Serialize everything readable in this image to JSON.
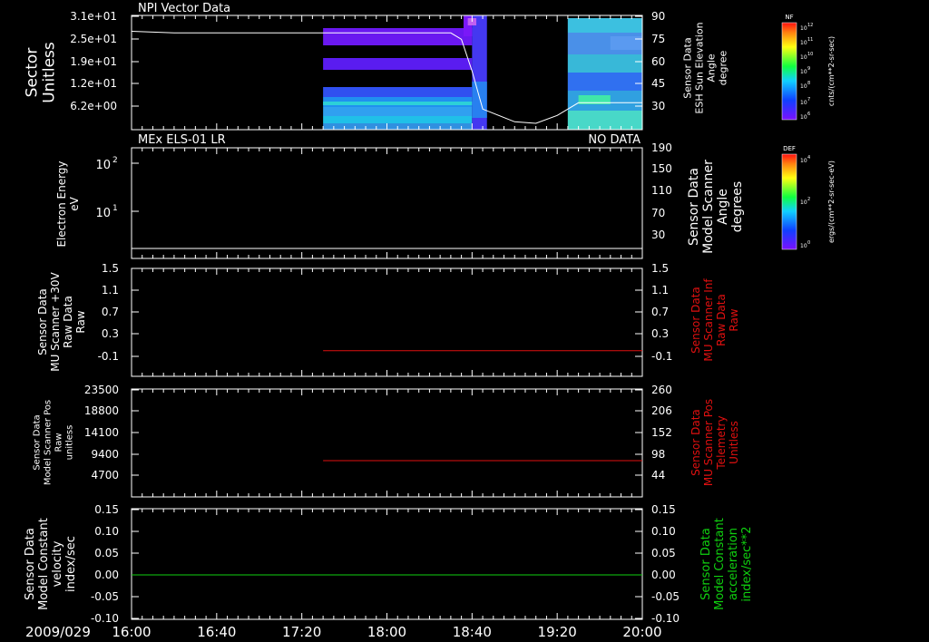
{
  "date_label": "2009/029",
  "x_ticks": [
    "16:00",
    "16:40",
    "17:20",
    "18:00",
    "18:40",
    "19:20",
    "20:00"
  ],
  "colors": {
    "axis": "#ffffff",
    "red": "#e01010",
    "green": "#10d010",
    "bg": "#000000"
  },
  "panels": [
    {
      "title": "NPI Vector Data",
      "status": "",
      "left_label": [
        "Sector",
        "Unitless"
      ],
      "left_ticks": [
        "3.1e+01",
        "2.5e+01",
        "1.9e+01",
        "1.2e+01",
        "6.2e+00"
      ],
      "right_label": [
        "Sensor Data",
        "ESH Sun Elevation",
        "Angle",
        "degree"
      ],
      "right_ticks": [
        "90",
        "75",
        "60",
        "45",
        "30"
      ]
    },
    {
      "title": "MEx ELS-01 LR",
      "status": "NO DATA",
      "left_label": [
        "Electron Energy",
        "eV"
      ],
      "left_ticks": [
        "10",
        "10"
      ],
      "left_tick_exps": [
        "2",
        "1"
      ],
      "right_label": [
        "Sensor Data",
        "Model Scanner",
        "Angle",
        "degrees"
      ],
      "right_ticks": [
        "190",
        "150",
        "110",
        "70",
        "30"
      ]
    },
    {
      "title": "",
      "status": "",
      "left_label": [
        "Sensor Data",
        "MU Scanner +30V",
        "Raw Data",
        "Raw"
      ],
      "left_ticks": [
        "1.5",
        "1.1",
        "0.7",
        "0.3",
        "-0.1"
      ],
      "right_label": [
        "Sensor Data",
        "MU Scanner Inf",
        "Raw Data",
        "Raw"
      ],
      "right_ticks": [
        "1.5",
        "1.1",
        "0.7",
        "0.3",
        "-0.1"
      ]
    },
    {
      "title": "",
      "status": "",
      "left_label": [
        "Sensor Data",
        "Model Scanner Pos",
        "Raw",
        "unitless"
      ],
      "left_ticks": [
        "23500",
        "18800",
        "14100",
        "9400",
        "4700"
      ],
      "right_label": [
        "Sensor Data",
        "MU Scanner Pos",
        "Telemetry",
        "Unitless"
      ],
      "right_ticks": [
        "260",
        "206",
        "152",
        "98",
        "44"
      ]
    },
    {
      "title": "",
      "status": "",
      "left_label": [
        "Sensor Data",
        "Model Constant",
        "velocity",
        "index/sec"
      ],
      "left_ticks": [
        "0.15",
        "0.10",
        "0.05",
        "0.00",
        "-0.05",
        "-0.10"
      ],
      "right_label": [
        "Sensor Data",
        "Model Constant",
        "acceleration",
        "index/sec**2"
      ],
      "right_ticks": [
        "0.15",
        "0.10",
        "0.05",
        "0.00",
        "-0.05",
        "-0.10"
      ]
    }
  ],
  "colorbars": [
    {
      "title": "NF",
      "unit": "cnts/(cm**2-sr-sec)",
      "ticks": [
        "10",
        "10",
        "10",
        "10",
        "10",
        "10",
        "10"
      ],
      "tick_exps": [
        "12",
        "11",
        "10",
        "9",
        "8",
        "7",
        "6"
      ]
    },
    {
      "title": "DEF",
      "unit": "ergs/(cm**2-sr-sec-eV)",
      "ticks": [
        "10",
        "10",
        "10"
      ],
      "tick_exps": [
        "4",
        "2",
        "0"
      ]
    }
  ],
  "chart_data": [
    {
      "type": "heatmap",
      "title": "NPI Vector Data",
      "xlabel": "",
      "ylabel": "Sector Unitless",
      "x_range": [
        "16:00",
        "20:00"
      ],
      "y_ticks": [
        31,
        25,
        19,
        12,
        6.2
      ],
      "overlay_line": {
        "name": "Sensor Data ESH Sun Elevation Angle",
        "unit": "degree",
        "x": [
          "16:00",
          "16:20",
          "18:30",
          "18:35",
          "18:40",
          "18:45",
          "19:00",
          "19:10",
          "19:20",
          "19:30",
          "20:00"
        ],
        "y": [
          80,
          79,
          79,
          75,
          55,
          31,
          23,
          22,
          27,
          35,
          35
        ]
      },
      "y2_ticks": [
        90,
        75,
        60,
        45,
        30
      ]
    },
    {
      "type": "line",
      "title": "MEx ELS-01 LR",
      "status": "NO DATA",
      "ylabel": "Electron Energy eV",
      "y_scale": "log",
      "series": [
        {
          "name": "Sensor Data Model Scanner Angle",
          "x": [
            "16:00",
            "20:00"
          ],
          "y": [
            16,
            16
          ]
        }
      ],
      "y2_ticks": [
        190,
        150,
        110,
        70,
        30
      ]
    },
    {
      "type": "line",
      "ylabel": "Sensor Data MU Scanner +30V Raw Data Raw",
      "ylim": [
        -0.3,
        1.5
      ],
      "series": [
        {
          "name": "Sensor Data MU Scanner Inf Raw Data Raw",
          "color": "#e01010",
          "x": [
            "17:30",
            "20:00"
          ],
          "y": [
            0.0,
            0.0
          ]
        }
      ]
    },
    {
      "type": "line",
      "ylabel": "Sensor Data Model Scanner Pos Raw unitless",
      "ylim": [
        0,
        23500
      ],
      "series": [
        {
          "name": "Sensor Data MU Scanner Pos Telemetry Unitless",
          "color": "#e01010",
          "x": [
            "17:30",
            "20:00"
          ],
          "y": [
            98,
            98
          ]
        }
      ],
      "y2_ticks": [
        260,
        206,
        152,
        98,
        44
      ]
    },
    {
      "type": "line",
      "ylabel": "Sensor Data Model Constant velocity index/sec",
      "ylim": [
        -0.1,
        0.15
      ],
      "series": [
        {
          "name": "Sensor Data Model Constant acceleration index/sec**2",
          "color": "#10d010",
          "x": [
            "16:00",
            "20:00"
          ],
          "y": [
            0.0,
            0.0
          ]
        }
      ]
    }
  ]
}
